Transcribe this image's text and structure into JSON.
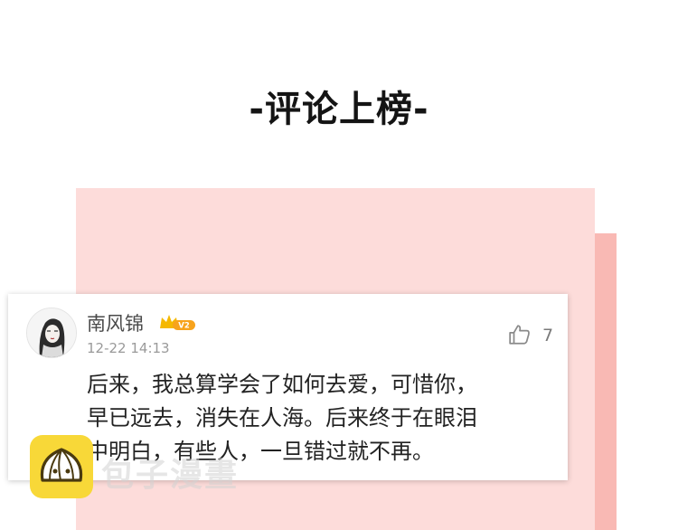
{
  "header": {
    "title": "-评论上榜-"
  },
  "comment": {
    "username": "南风锦",
    "badge": "V2",
    "timestamp": "12-22 14:13",
    "like_count": "7",
    "lines": [
      "后来，我总算学会了如何去爱，可惜你，",
      "早已远去，消失在人海。后来终于在眼泪",
      "中明白，有些人，一旦错过就不再。"
    ]
  },
  "watermark": {
    "text": "包子漫畫"
  },
  "colors": {
    "panel_pink": "#fddcda",
    "strip_pink": "#f9b9b4",
    "badge_gold": "#f5b800",
    "logo_yellow": "#f8d838"
  },
  "icons": [
    "avatar",
    "crown-badge-icon",
    "thumbs-up-icon",
    "bun-logo-icon"
  ]
}
